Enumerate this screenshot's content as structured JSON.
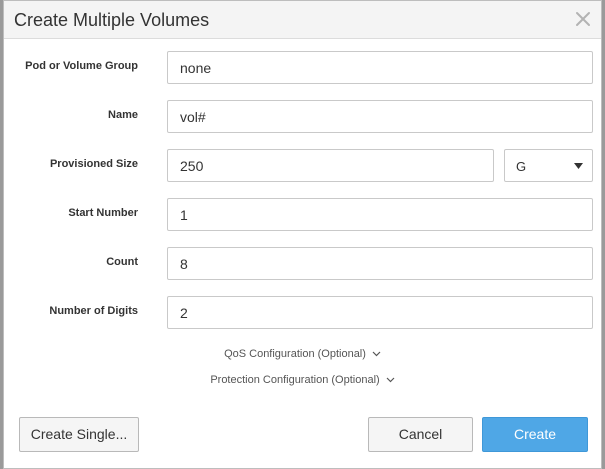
{
  "dialog": {
    "title": "Create Multiple Volumes"
  },
  "form": {
    "pod_group": {
      "label": "Pod or Volume Group",
      "value": "none"
    },
    "name": {
      "label": "Name",
      "value": "vol#"
    },
    "size": {
      "label": "Provisioned Size",
      "value": "250",
      "unit": "G"
    },
    "start": {
      "label": "Start Number",
      "value": "1"
    },
    "count": {
      "label": "Count",
      "value": "8"
    },
    "digits": {
      "label": "Number of Digits",
      "value": "2"
    }
  },
  "sections": {
    "qos": "QoS Configuration (Optional)",
    "protection": "Protection Configuration (Optional)"
  },
  "buttons": {
    "create_single": "Create Single...",
    "cancel": "Cancel",
    "create": "Create"
  },
  "colors": {
    "primary_button": "#4fa7e6",
    "header_bg": "#f4f4f4"
  }
}
